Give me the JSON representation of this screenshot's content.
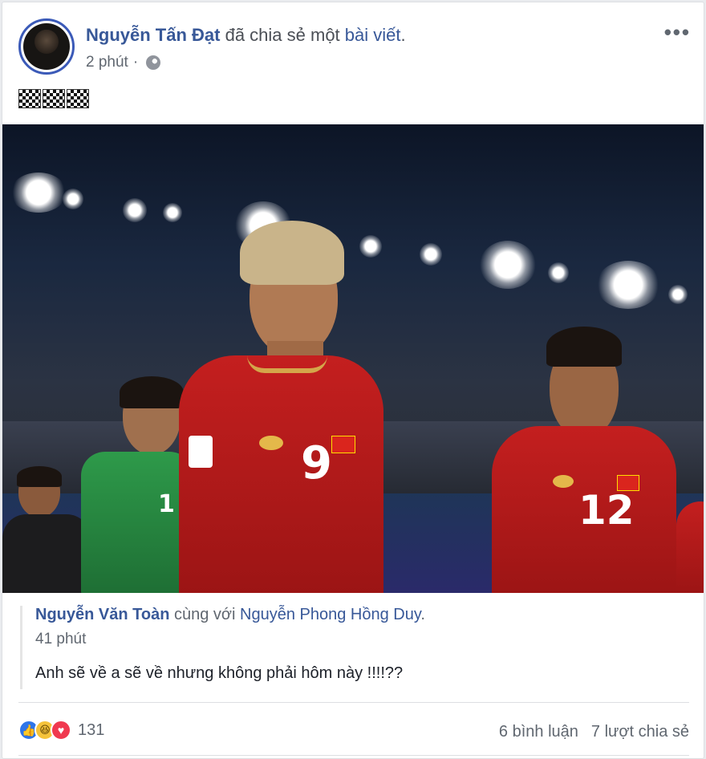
{
  "post": {
    "author": "Nguyễn Tấn Đạt",
    "verb": "đã chia sẻ một",
    "object": "bài viết",
    "period": ".",
    "time": "2 phút",
    "separator": "·",
    "audience_icon": "globe-icon",
    "more_icon": "ellipsis-icon",
    "more_label": "•••",
    "status_icons": [
      "checkered-flag-icon",
      "checkered-flag-icon",
      "checkered-flag-icon"
    ]
  },
  "photo": {
    "jersey_numbers": [
      "9",
      "12",
      "1"
    ]
  },
  "shared": {
    "author": "Nguyễn Văn Toàn",
    "with": "cùng với",
    "tagged": "Nguyễn Phong Hồng Duy",
    "period": ".",
    "time": "41 phút",
    "text": "Anh sẽ về a sẽ về nhưng không phải hôm này !!!!??"
  },
  "footer": {
    "reaction_icons": [
      "like-icon",
      "haha-icon",
      "love-icon"
    ],
    "reaction_count": "131",
    "comments": "6 bình luận",
    "shares": "7 lượt chia sẻ"
  },
  "colors": {
    "link": "#385898",
    "secondary_text": "#606770",
    "like": "#2e75e8",
    "haha": "#f5c33b",
    "love": "#f0394f",
    "jersey_red": "#c41f1f",
    "goalkeeper_green": "#2e9a4a"
  }
}
